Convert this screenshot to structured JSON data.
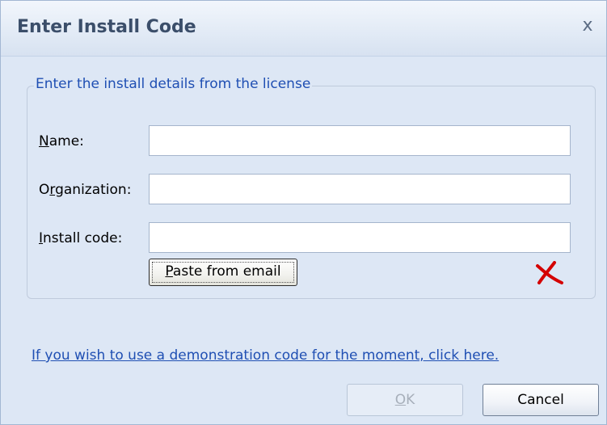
{
  "window": {
    "title": "Enter Install Code",
    "close_glyph": "x"
  },
  "group": {
    "legend": "Enter the install details from the license"
  },
  "fields": {
    "name": {
      "label_access": "N",
      "label_rest": "ame:",
      "value": ""
    },
    "organization": {
      "label_pre": "O",
      "label_access": "r",
      "label_rest": "ganization:",
      "value": ""
    },
    "install_code": {
      "label_access": "I",
      "label_rest": "nstall code:",
      "value": ""
    }
  },
  "paste_button": {
    "label_access": "P",
    "label_rest": "aste from email"
  },
  "status_icon": "red-x-icon",
  "demo_link": "If you wish to use a demonstration code for the moment, click here.",
  "buttons": {
    "ok_access": "O",
    "ok_rest": "K",
    "cancel": "Cancel"
  },
  "colors": {
    "link": "#1f4fb3",
    "error_mark": "#d40000",
    "title_text": "#3b4e6a"
  }
}
